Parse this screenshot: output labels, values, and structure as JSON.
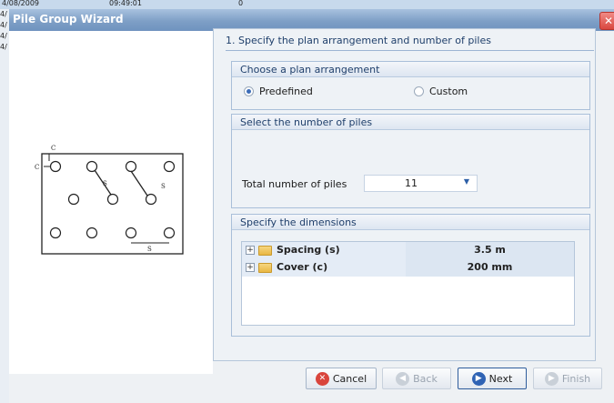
{
  "background": {
    "row_date": "4/08/2009",
    "row_time": "09:49:01",
    "row_num": "0",
    "side_labels": [
      "4/",
      "4/",
      "4/",
      "4/"
    ]
  },
  "window": {
    "title": "Pile Group Wizard",
    "close_glyph": "✕"
  },
  "diagram": {
    "c1": "C",
    "c2": "C",
    "s1": "S",
    "s2": "S",
    "s3": "S"
  },
  "step": {
    "heading": "1. Specify the plan arrangement and number of piles"
  },
  "arrangement": {
    "header": "Choose a plan arrangement",
    "options": [
      {
        "label": "Predefined",
        "selected": true
      },
      {
        "label": "Custom",
        "selected": false
      }
    ]
  },
  "piles": {
    "header": "Select the number of piles",
    "label": "Total number of piles",
    "value": "11",
    "dropdown_icon": "chevron-down-icon"
  },
  "dimensions": {
    "header": "Specify the dimensions",
    "rows": [
      {
        "name": "Spacing (s)",
        "value": "3.5 m"
      },
      {
        "name": "Cover (c)",
        "value": "200 mm"
      }
    ]
  },
  "buttons": {
    "cancel": "Cancel",
    "back": "Back",
    "next": "Next",
    "finish": "Finish"
  },
  "colors": {
    "accent": "#2f63b4",
    "title_bar": "#7e9fc6",
    "desktop": "#b3262b"
  }
}
